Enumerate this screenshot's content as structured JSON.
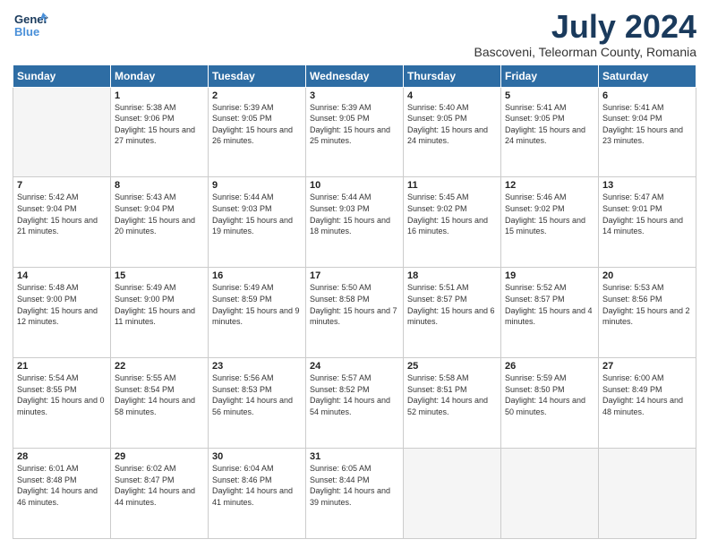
{
  "header": {
    "logo_general": "General",
    "logo_blue": "Blue",
    "month_title": "July 2024",
    "location": "Bascoveni, Teleorman County, Romania"
  },
  "days_of_week": [
    "Sunday",
    "Monday",
    "Tuesday",
    "Wednesday",
    "Thursday",
    "Friday",
    "Saturday"
  ],
  "weeks": [
    [
      {
        "day": "",
        "empty": true
      },
      {
        "day": "1",
        "sunrise": "Sunrise: 5:38 AM",
        "sunset": "Sunset: 9:06 PM",
        "daylight": "Daylight: 15 hours and 27 minutes."
      },
      {
        "day": "2",
        "sunrise": "Sunrise: 5:39 AM",
        "sunset": "Sunset: 9:05 PM",
        "daylight": "Daylight: 15 hours and 26 minutes."
      },
      {
        "day": "3",
        "sunrise": "Sunrise: 5:39 AM",
        "sunset": "Sunset: 9:05 PM",
        "daylight": "Daylight: 15 hours and 25 minutes."
      },
      {
        "day": "4",
        "sunrise": "Sunrise: 5:40 AM",
        "sunset": "Sunset: 9:05 PM",
        "daylight": "Daylight: 15 hours and 24 minutes."
      },
      {
        "day": "5",
        "sunrise": "Sunrise: 5:41 AM",
        "sunset": "Sunset: 9:05 PM",
        "daylight": "Daylight: 15 hours and 24 minutes."
      },
      {
        "day": "6",
        "sunrise": "Sunrise: 5:41 AM",
        "sunset": "Sunset: 9:04 PM",
        "daylight": "Daylight: 15 hours and 23 minutes."
      }
    ],
    [
      {
        "day": "7",
        "sunrise": "Sunrise: 5:42 AM",
        "sunset": "Sunset: 9:04 PM",
        "daylight": "Daylight: 15 hours and 21 minutes."
      },
      {
        "day": "8",
        "sunrise": "Sunrise: 5:43 AM",
        "sunset": "Sunset: 9:04 PM",
        "daylight": "Daylight: 15 hours and 20 minutes."
      },
      {
        "day": "9",
        "sunrise": "Sunrise: 5:44 AM",
        "sunset": "Sunset: 9:03 PM",
        "daylight": "Daylight: 15 hours and 19 minutes."
      },
      {
        "day": "10",
        "sunrise": "Sunrise: 5:44 AM",
        "sunset": "Sunset: 9:03 PM",
        "daylight": "Daylight: 15 hours and 18 minutes."
      },
      {
        "day": "11",
        "sunrise": "Sunrise: 5:45 AM",
        "sunset": "Sunset: 9:02 PM",
        "daylight": "Daylight: 15 hours and 16 minutes."
      },
      {
        "day": "12",
        "sunrise": "Sunrise: 5:46 AM",
        "sunset": "Sunset: 9:02 PM",
        "daylight": "Daylight: 15 hours and 15 minutes."
      },
      {
        "day": "13",
        "sunrise": "Sunrise: 5:47 AM",
        "sunset": "Sunset: 9:01 PM",
        "daylight": "Daylight: 15 hours and 14 minutes."
      }
    ],
    [
      {
        "day": "14",
        "sunrise": "Sunrise: 5:48 AM",
        "sunset": "Sunset: 9:00 PM",
        "daylight": "Daylight: 15 hours and 12 minutes."
      },
      {
        "day": "15",
        "sunrise": "Sunrise: 5:49 AM",
        "sunset": "Sunset: 9:00 PM",
        "daylight": "Daylight: 15 hours and 11 minutes."
      },
      {
        "day": "16",
        "sunrise": "Sunrise: 5:49 AM",
        "sunset": "Sunset: 8:59 PM",
        "daylight": "Daylight: 15 hours and 9 minutes."
      },
      {
        "day": "17",
        "sunrise": "Sunrise: 5:50 AM",
        "sunset": "Sunset: 8:58 PM",
        "daylight": "Daylight: 15 hours and 7 minutes."
      },
      {
        "day": "18",
        "sunrise": "Sunrise: 5:51 AM",
        "sunset": "Sunset: 8:57 PM",
        "daylight": "Daylight: 15 hours and 6 minutes."
      },
      {
        "day": "19",
        "sunrise": "Sunrise: 5:52 AM",
        "sunset": "Sunset: 8:57 PM",
        "daylight": "Daylight: 15 hours and 4 minutes."
      },
      {
        "day": "20",
        "sunrise": "Sunrise: 5:53 AM",
        "sunset": "Sunset: 8:56 PM",
        "daylight": "Daylight: 15 hours and 2 minutes."
      }
    ],
    [
      {
        "day": "21",
        "sunrise": "Sunrise: 5:54 AM",
        "sunset": "Sunset: 8:55 PM",
        "daylight": "Daylight: 15 hours and 0 minutes."
      },
      {
        "day": "22",
        "sunrise": "Sunrise: 5:55 AM",
        "sunset": "Sunset: 8:54 PM",
        "daylight": "Daylight: 14 hours and 58 minutes."
      },
      {
        "day": "23",
        "sunrise": "Sunrise: 5:56 AM",
        "sunset": "Sunset: 8:53 PM",
        "daylight": "Daylight: 14 hours and 56 minutes."
      },
      {
        "day": "24",
        "sunrise": "Sunrise: 5:57 AM",
        "sunset": "Sunset: 8:52 PM",
        "daylight": "Daylight: 14 hours and 54 minutes."
      },
      {
        "day": "25",
        "sunrise": "Sunrise: 5:58 AM",
        "sunset": "Sunset: 8:51 PM",
        "daylight": "Daylight: 14 hours and 52 minutes."
      },
      {
        "day": "26",
        "sunrise": "Sunrise: 5:59 AM",
        "sunset": "Sunset: 8:50 PM",
        "daylight": "Daylight: 14 hours and 50 minutes."
      },
      {
        "day": "27",
        "sunrise": "Sunrise: 6:00 AM",
        "sunset": "Sunset: 8:49 PM",
        "daylight": "Daylight: 14 hours and 48 minutes."
      }
    ],
    [
      {
        "day": "28",
        "sunrise": "Sunrise: 6:01 AM",
        "sunset": "Sunset: 8:48 PM",
        "daylight": "Daylight: 14 hours and 46 minutes."
      },
      {
        "day": "29",
        "sunrise": "Sunrise: 6:02 AM",
        "sunset": "Sunset: 8:47 PM",
        "daylight": "Daylight: 14 hours and 44 minutes."
      },
      {
        "day": "30",
        "sunrise": "Sunrise: 6:04 AM",
        "sunset": "Sunset: 8:46 PM",
        "daylight": "Daylight: 14 hours and 41 minutes."
      },
      {
        "day": "31",
        "sunrise": "Sunrise: 6:05 AM",
        "sunset": "Sunset: 8:44 PM",
        "daylight": "Daylight: 14 hours and 39 minutes."
      },
      {
        "day": "",
        "empty": true
      },
      {
        "day": "",
        "empty": true
      },
      {
        "day": "",
        "empty": true
      }
    ]
  ]
}
